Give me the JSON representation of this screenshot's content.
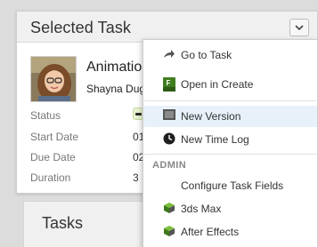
{
  "panel": {
    "title": "Selected Task",
    "task_name": "Animatio",
    "assignee": "Shayna Dug",
    "fields": [
      {
        "label": "Status",
        "value": ""
      },
      {
        "label": "Start Date",
        "value": "01"
      },
      {
        "label": "Due Date",
        "value": "02"
      },
      {
        "label": "Duration",
        "value": "3"
      }
    ]
  },
  "tasks_panel": {
    "title": "Tasks"
  },
  "menu": {
    "items": [
      {
        "label": "Go to Task",
        "icon": "arrow-forward-icon"
      },
      {
        "label": "Open in Create",
        "icon": "fusion-create-icon"
      },
      {
        "label": "New Version",
        "icon": "film-version-icon"
      },
      {
        "label": "New Time Log",
        "icon": "clock-icon"
      }
    ],
    "section": "ADMIN",
    "admin_items": [
      {
        "label": "Configure Task Fields",
        "icon": ""
      },
      {
        "label": "3ds Max",
        "icon": "3ds-max-icon"
      },
      {
        "label": "After Effects",
        "icon": "after-effects-icon"
      }
    ]
  },
  "colors": {
    "menu_hover": "#e8f1fa",
    "status_badge": "#e9f3d2",
    "app_icon_green": "#5a9a2a"
  }
}
